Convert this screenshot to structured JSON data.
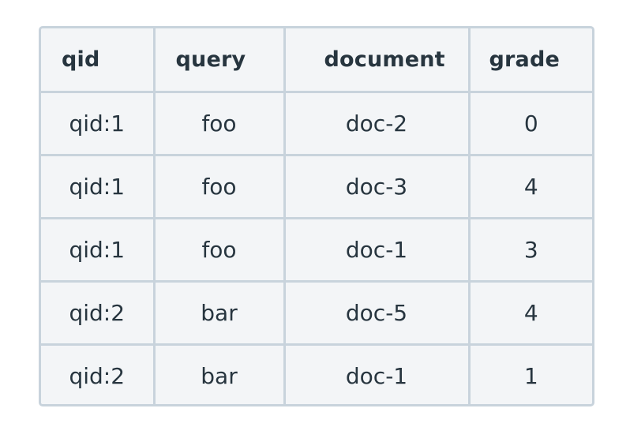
{
  "table": {
    "headers": [
      "qid",
      "query",
      "document",
      "grade"
    ],
    "rows": [
      [
        "qid:1",
        "foo",
        "doc-2",
        "0"
      ],
      [
        "qid:1",
        "foo",
        "doc-3",
        "4"
      ],
      [
        "qid:1",
        "foo",
        "doc-1",
        "3"
      ],
      [
        "qid:2",
        "bar",
        "doc-5",
        "4"
      ],
      [
        "qid:2",
        "bar",
        "doc-1",
        "1"
      ]
    ]
  }
}
